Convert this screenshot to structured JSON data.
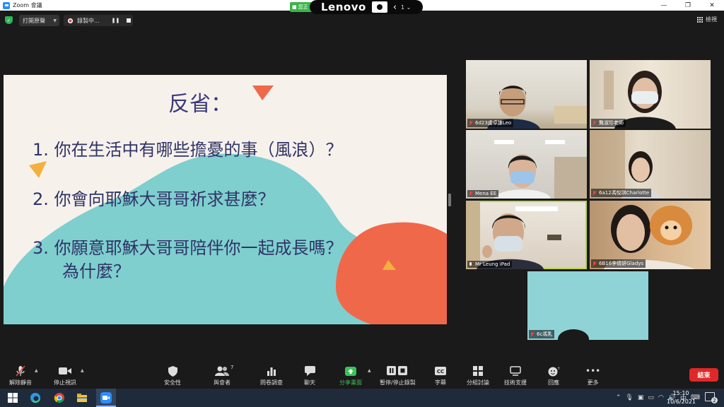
{
  "window": {
    "title": "Zoom 會議",
    "minimize": "—",
    "maximize": "❐",
    "close": "✕"
  },
  "overlay": {
    "brand": "Lenovo",
    "green_label": "您正",
    "extra": "1 ⌄"
  },
  "meeting_bar": {
    "audio_label": "打開原聲",
    "recording_label": "錄製中...",
    "view_label": "檢視"
  },
  "slide": {
    "title": "反省：",
    "questions": [
      "1. 你在生活中有哪些擔憂的事（風浪）？",
      "2. 你會向耶穌大哥哥祈求甚麼？",
      "3. 你願意耶穌大哥哥陪伴你一起成長嗎？",
      "為什麼？"
    ],
    "colors": {
      "teal": "#7fcfcf",
      "orange": "#f0684a",
      "gold": "#f2b13f",
      "bg": "#f7f1ec"
    }
  },
  "participants": [
    {
      "name": "6d23盧卓謙Leo",
      "muted": true
    },
    {
      "name": "龔淑珍老師",
      "muted": true
    },
    {
      "name": "Mena EE",
      "muted": true
    },
    {
      "name": "6a12馮悅琪Charlotte",
      "muted": true
    },
    {
      "name": "Mr Leung iPad",
      "muted": false,
      "active": true
    },
    {
      "name": "6B16李倩妍Gladys",
      "muted": true
    },
    {
      "name": "6c馮乳",
      "muted": true
    }
  ],
  "toolbar": {
    "unmute": "解除靜音",
    "stop_video": "停止視訊",
    "security": "安全性",
    "participants": "與會者",
    "participants_count": "7",
    "polls": "問卷調查",
    "chat": "聊天",
    "share": "分享畫面",
    "record": "暫停/停止錄製",
    "captions": "字幕",
    "breakout": "分組討論",
    "support": "技術支援",
    "reactions": "回應",
    "more": "更多",
    "end": "結束"
  },
  "taskbar": {
    "time": "15:10",
    "date": "10/6/2021",
    "ime": "中",
    "notifications": "2"
  }
}
